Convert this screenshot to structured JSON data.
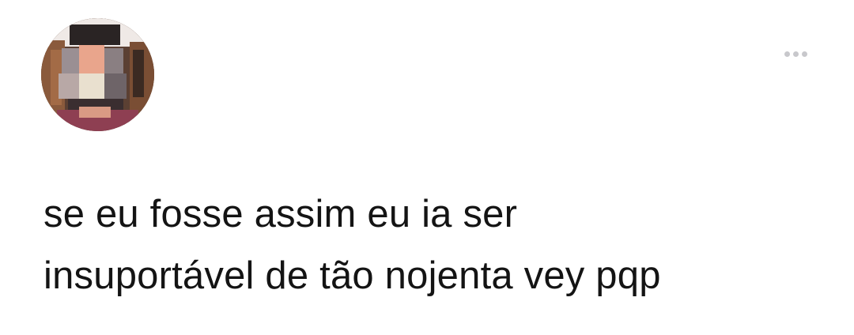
{
  "post": {
    "text_lines": [
      "se eu fosse assim eu ia ser",
      "insuportável de tão nojenta vey pqp"
    ],
    "avatar_icon": "pixelated-profile-photo",
    "more_icon": "more-horizontal-icon"
  },
  "colors": {
    "background": "#ffffff",
    "text": "#141414",
    "more_dots": "#c8c8cc"
  }
}
